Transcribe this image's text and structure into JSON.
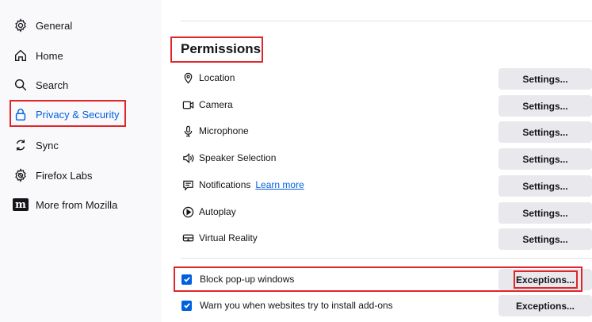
{
  "sidebar": {
    "items": [
      {
        "label": "General",
        "icon": "gear-icon"
      },
      {
        "label": "Home",
        "icon": "home-icon"
      },
      {
        "label": "Search",
        "icon": "search-icon"
      },
      {
        "label": "Privacy & Security",
        "icon": "lock-icon",
        "active": true
      },
      {
        "label": "Sync",
        "icon": "sync-icon"
      },
      {
        "label": "Firefox Labs",
        "icon": "labs-icon"
      },
      {
        "label": "More from Mozilla",
        "icon": "mozilla-logo-icon"
      }
    ]
  },
  "permissions": {
    "title": "Permissions",
    "rows": [
      {
        "label": "Location",
        "icon": "location-icon",
        "button": "Settings..."
      },
      {
        "label": "Camera",
        "icon": "camera-icon",
        "button": "Settings..."
      },
      {
        "label": "Microphone",
        "icon": "microphone-icon",
        "button": "Settings..."
      },
      {
        "label": "Speaker Selection",
        "icon": "speaker-icon",
        "button": "Settings..."
      },
      {
        "label": "Notifications",
        "icon": "notification-icon",
        "button": "Settings...",
        "link": "Learn more"
      },
      {
        "label": "Autoplay",
        "icon": "autoplay-icon",
        "button": "Settings..."
      },
      {
        "label": "Virtual Reality",
        "icon": "vr-icon",
        "button": "Settings..."
      }
    ]
  },
  "checks": [
    {
      "label": "Block pop-up windows",
      "checked": true,
      "button": "Exceptions..."
    },
    {
      "label": "Warn you when websites try to install add-ons",
      "checked": true,
      "button": "Exceptions..."
    }
  ],
  "colors": {
    "accent": "#0061e0",
    "highlight": "#e0262a",
    "button_bg": "#e9e9ed",
    "sidebar_bg": "#f9f9fb"
  }
}
